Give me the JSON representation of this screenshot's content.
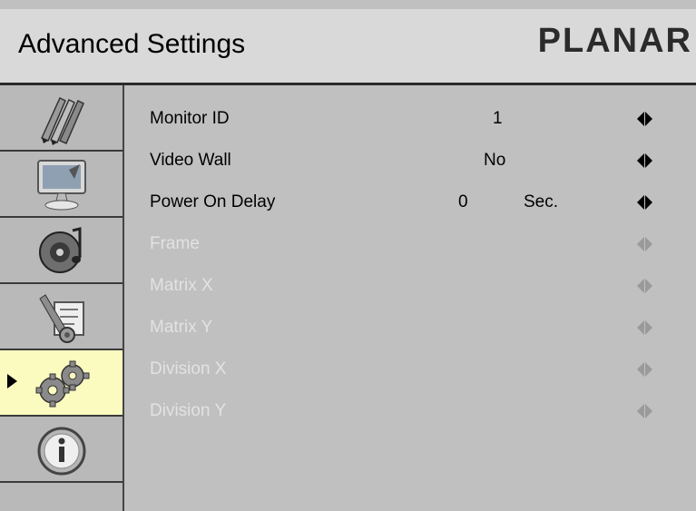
{
  "header": {
    "title": "Advanced Settings",
    "brand": "PLANAR"
  },
  "sidebar": {
    "items": [
      {
        "icon": "pens-icon",
        "active": false
      },
      {
        "icon": "monitor-icon",
        "active": false
      },
      {
        "icon": "audio-speaker-icon",
        "active": false
      },
      {
        "icon": "tools-settings-icon",
        "active": false
      },
      {
        "icon": "gears-icon",
        "active": true
      },
      {
        "icon": "info-icon",
        "active": false
      }
    ]
  },
  "menu": {
    "items": [
      {
        "label": "Monitor ID",
        "value": "1",
        "enabled": true
      },
      {
        "label": "Video Wall",
        "value": "No",
        "enabled": true
      },
      {
        "label": "Power On Delay",
        "value": "0",
        "unit": "Sec.",
        "enabled": true
      },
      {
        "label": "Frame",
        "enabled": false
      },
      {
        "label": "Matrix X",
        "enabled": false
      },
      {
        "label": "Matrix Y",
        "enabled": false
      },
      {
        "label": "Division X",
        "enabled": false
      },
      {
        "label": "Division Y",
        "enabled": false
      }
    ]
  },
  "colors": {
    "background": "#c0c0c0",
    "header": "#d9d9d9",
    "active_highlight": "#fbfbc0",
    "disabled_text": "#e2e2e2"
  }
}
